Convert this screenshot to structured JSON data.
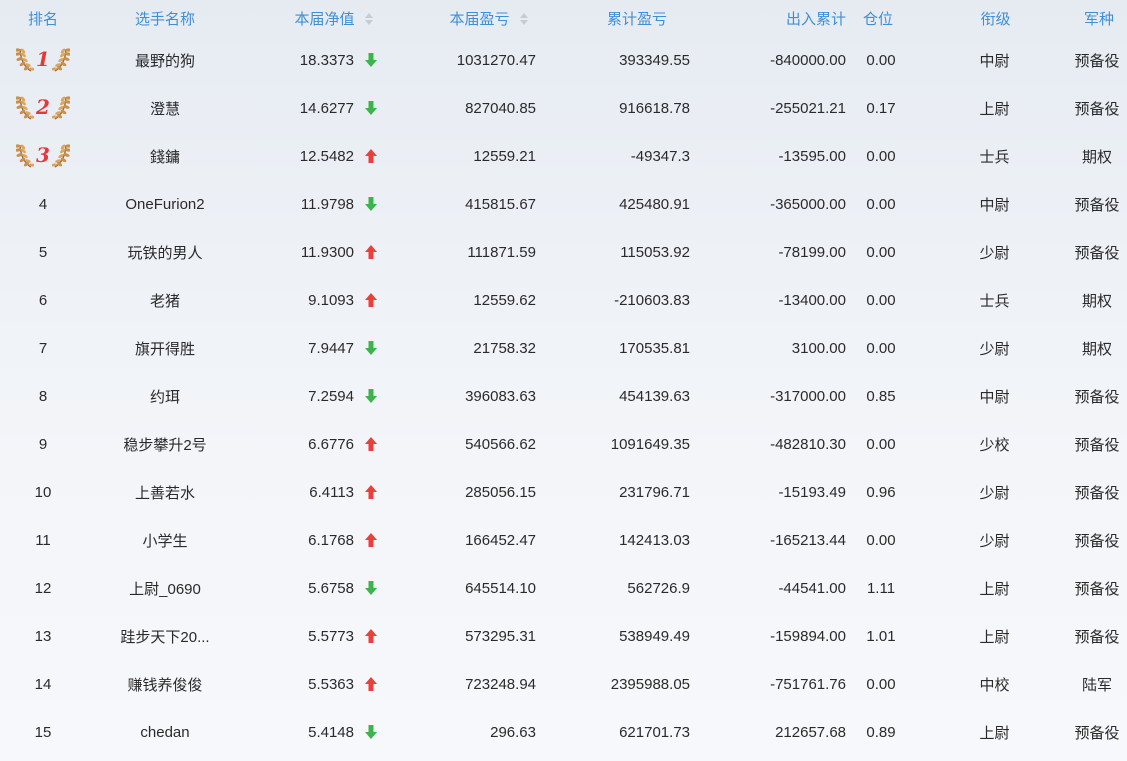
{
  "headers": {
    "rank": "排名",
    "name": "选手名称",
    "nav": "本届净值",
    "pnl": "本届盈亏",
    "cum_pnl": "累计盈亏",
    "flow": "出入累计",
    "position": "仓位",
    "grade": "衔级",
    "branch": "军种"
  },
  "colors": {
    "header_text": "#3f8fd6",
    "up": "#e8413c",
    "down": "#3cb44b",
    "medal_number": "#e23a3a"
  },
  "rows": [
    {
      "rank": "1",
      "medal": true,
      "name": "最野的狗",
      "nav": "18.3373",
      "trend": "down",
      "pnl": "1031270.47",
      "cum_pnl": "393349.55",
      "flow": "-840000.00",
      "position": "0.00",
      "grade": "中尉",
      "branch": "预备役"
    },
    {
      "rank": "2",
      "medal": true,
      "name": "澄慧",
      "nav": "14.6277",
      "trend": "down",
      "pnl": "827040.85",
      "cum_pnl": "916618.78",
      "flow": "-255021.21",
      "position": "0.17",
      "grade": "上尉",
      "branch": "预备役"
    },
    {
      "rank": "3",
      "medal": true,
      "name": "錢鏞",
      "nav": "12.5482",
      "trend": "up",
      "pnl": "12559.21",
      "cum_pnl": "-49347.3",
      "flow": "-13595.00",
      "position": "0.00",
      "grade": "士兵",
      "branch": "期权"
    },
    {
      "rank": "4",
      "medal": false,
      "name": "OneFurion2",
      "nav": "11.9798",
      "trend": "down",
      "pnl": "415815.67",
      "cum_pnl": "425480.91",
      "flow": "-365000.00",
      "position": "0.00",
      "grade": "中尉",
      "branch": "预备役"
    },
    {
      "rank": "5",
      "medal": false,
      "name": "玩铁的男人",
      "nav": "11.9300",
      "trend": "up",
      "pnl": "111871.59",
      "cum_pnl": "115053.92",
      "flow": "-78199.00",
      "position": "0.00",
      "grade": "少尉",
      "branch": "预备役"
    },
    {
      "rank": "6",
      "medal": false,
      "name": "老猪",
      "nav": "9.1093",
      "trend": "up",
      "pnl": "12559.62",
      "cum_pnl": "-210603.83",
      "flow": "-13400.00",
      "position": "0.00",
      "grade": "士兵",
      "branch": "期权"
    },
    {
      "rank": "7",
      "medal": false,
      "name": "旗开得胜",
      "nav": "7.9447",
      "trend": "down",
      "pnl": "21758.32",
      "cum_pnl": "170535.81",
      "flow": "3100.00",
      "position": "0.00",
      "grade": "少尉",
      "branch": "期权"
    },
    {
      "rank": "8",
      "medal": false,
      "name": "约珥",
      "nav": "7.2594",
      "trend": "down",
      "pnl": "396083.63",
      "cum_pnl": "454139.63",
      "flow": "-317000.00",
      "position": "0.85",
      "grade": "中尉",
      "branch": "预备役"
    },
    {
      "rank": "9",
      "medal": false,
      "name": "稳步攀升2号",
      "nav": "6.6776",
      "trend": "up",
      "pnl": "540566.62",
      "cum_pnl": "1091649.35",
      "flow": "-482810.30",
      "position": "0.00",
      "grade": "少校",
      "branch": "预备役"
    },
    {
      "rank": "10",
      "medal": false,
      "name": "上善若水",
      "nav": "6.4113",
      "trend": "up",
      "pnl": "285056.15",
      "cum_pnl": "231796.71",
      "flow": "-15193.49",
      "position": "0.96",
      "grade": "少尉",
      "branch": "预备役"
    },
    {
      "rank": "11",
      "medal": false,
      "name": "小学生",
      "nav": "6.1768",
      "trend": "up",
      "pnl": "166452.47",
      "cum_pnl": "142413.03",
      "flow": "-165213.44",
      "position": "0.00",
      "grade": "少尉",
      "branch": "预备役"
    },
    {
      "rank": "12",
      "medal": false,
      "name": "上尉_0690",
      "nav": "5.6758",
      "trend": "down",
      "pnl": "645514.10",
      "cum_pnl": "562726.9",
      "flow": "-44541.00",
      "position": "1.11",
      "grade": "上尉",
      "branch": "预备役"
    },
    {
      "rank": "13",
      "medal": false,
      "name": "跬步天下20...",
      "nav": "5.5773",
      "trend": "up",
      "pnl": "573295.31",
      "cum_pnl": "538949.49",
      "flow": "-159894.00",
      "position": "1.01",
      "grade": "上尉",
      "branch": "预备役"
    },
    {
      "rank": "14",
      "medal": false,
      "name": "赚钱养俊俊",
      "nav": "5.5363",
      "trend": "up",
      "pnl": "723248.94",
      "cum_pnl": "2395988.05",
      "flow": "-751761.76",
      "position": "0.00",
      "grade": "中校",
      "branch": "陆军"
    },
    {
      "rank": "15",
      "medal": false,
      "name": "chedan",
      "nav": "5.4148",
      "trend": "down",
      "pnl": "296.63",
      "cum_pnl": "621701.73",
      "flow": "212657.68",
      "position": "0.89",
      "grade": "上尉",
      "branch": "预备役"
    }
  ]
}
